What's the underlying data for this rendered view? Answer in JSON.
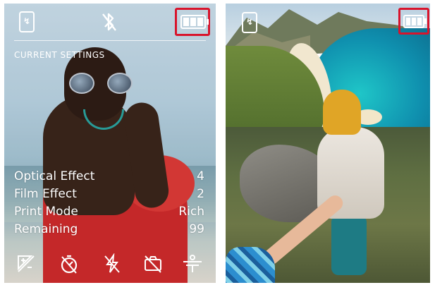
{
  "left_screen": {
    "section_label": "CURRENT SETTINGS",
    "settings": [
      {
        "label": "Optical Effect",
        "value": "4"
      },
      {
        "label": "Film Effect",
        "value": "2"
      },
      {
        "label": "Print Mode",
        "value": "Rich"
      },
      {
        "label": "Remaining",
        "value": "99"
      }
    ],
    "top_icons": [
      "phone-connection-icon",
      "bluetooth-off-icon",
      "battery-full-icon"
    ],
    "bottom_icons": [
      "exposure-icon",
      "self-timer-icon",
      "flash-off-icon",
      "camera-off-icon",
      "vignette-icon"
    ]
  },
  "right_screen": {
    "top_icons": [
      "phone-connection-icon",
      "battery-full-icon"
    ]
  },
  "colors": {
    "highlight": "#d8142c",
    "icon": "#ffffff"
  }
}
